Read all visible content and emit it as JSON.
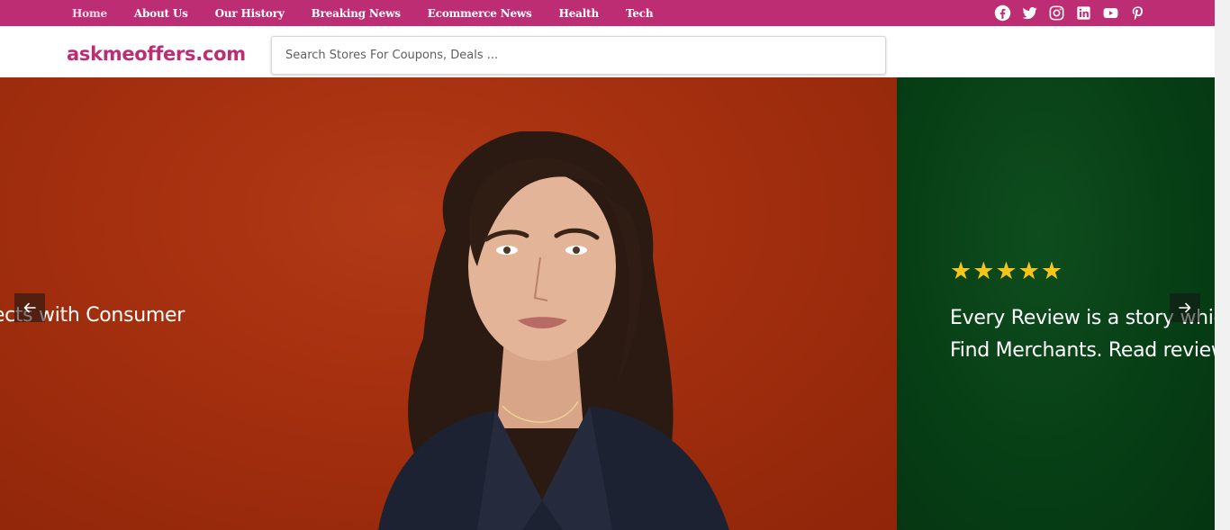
{
  "nav": {
    "items": [
      {
        "label": "Home",
        "active": true
      },
      {
        "label": "About Us"
      },
      {
        "label": "Our History"
      },
      {
        "label": "Breaking News"
      },
      {
        "label": "Ecommerce News"
      },
      {
        "label": "Health"
      },
      {
        "label": "Tech"
      }
    ],
    "social_icons": [
      "facebook-icon",
      "twitter-icon",
      "instagram-icon",
      "linkedin-icon",
      "youtube-icon",
      "pinterest-icon"
    ]
  },
  "header": {
    "logo": "askmeoffers.com",
    "search_placeholder": "Search Stores For Coupons, Deals ..."
  },
  "carousel": {
    "left_slide_text": "ects with Consumer",
    "right_slide_stars": "★★★★★",
    "right_slide_line1": "Every Review is a story which",
    "right_slide_line2": "Find Merchants. Read reviews",
    "prev_icon": "arrow-left-icon",
    "next_icon": "arrow-right-icon"
  },
  "colors": {
    "brand": "#bd2d73",
    "slide_red": "#a5300f",
    "slide_green": "#073f15",
    "star": "#f5c518"
  }
}
